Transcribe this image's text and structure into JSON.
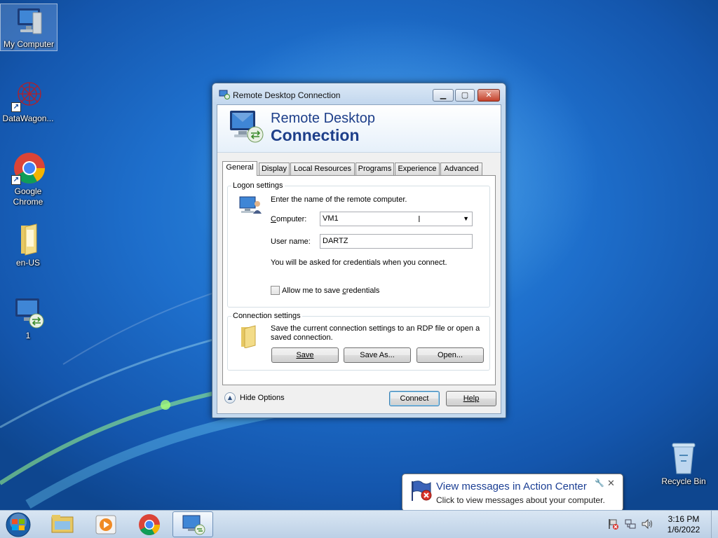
{
  "desktop": {
    "icons": [
      {
        "label": "My Computer"
      },
      {
        "label": "DataWagon..."
      },
      {
        "label": "Google Chrome"
      },
      {
        "label": "en-US"
      },
      {
        "label": "1"
      },
      {
        "label": "Recycle Bin"
      }
    ]
  },
  "window": {
    "title": "Remote Desktop Connection",
    "banner_line1": "Remote Desktop",
    "banner_line2": "Connection",
    "tabs": [
      {
        "label": "General"
      },
      {
        "label": "Display"
      },
      {
        "label": "Local Resources"
      },
      {
        "label": "Programs"
      },
      {
        "label": "Experience"
      },
      {
        "label": "Advanced"
      }
    ],
    "logon": {
      "group_label": "Logon settings",
      "intro": "Enter the name of the remote computer.",
      "computer_label": "Computer:",
      "computer_value": "VM1",
      "username_label": "User name:",
      "username_value": "DARTZ",
      "credentials_note": "You will be asked for credentials when you connect.",
      "save_credentials_label": "Allow me to save credentials",
      "save_credentials_checked": false
    },
    "connection": {
      "group_label": "Connection settings",
      "description": "Save the current connection settings to an RDP file or open a saved connection.",
      "save_label": "Save",
      "save_as_label": "Save As...",
      "open_label": "Open..."
    },
    "hide_options_label": "Hide Options",
    "connect_label": "Connect",
    "help_label": "Help"
  },
  "balloon": {
    "title": "View messages in Action Center",
    "text": "Click to view messages about your computer."
  },
  "taskbar": {
    "time": "3:16 PM",
    "date": "1/6/2022"
  },
  "colors": {
    "desktop_blue": "#1e6fcc",
    "title_text": "#1e3f8a",
    "close_red": "#c4412a"
  }
}
